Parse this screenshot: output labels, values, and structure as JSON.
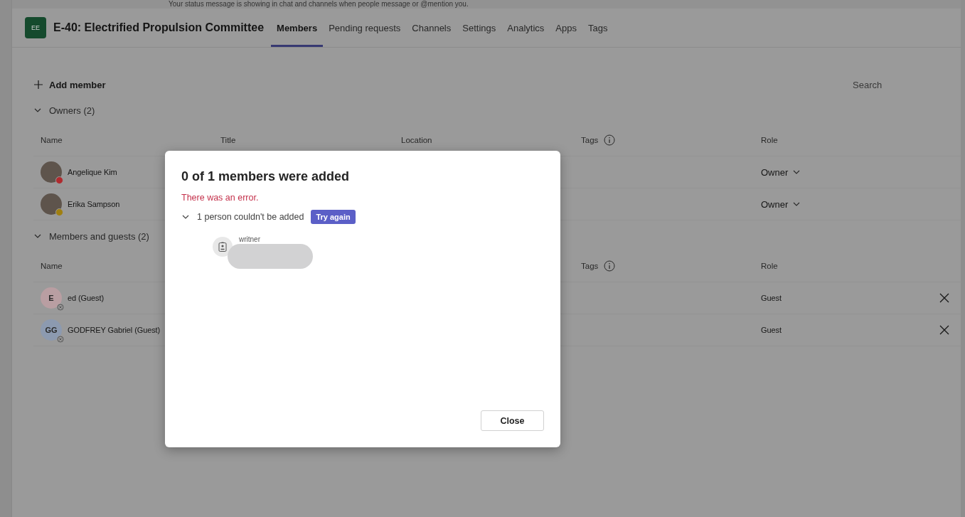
{
  "banner": {
    "text": "Your status message is showing in chat and channels when people message or @mention you."
  },
  "team": {
    "initials": "EE",
    "name": "E-40: Electrified Propulsion Committee"
  },
  "tabs": [
    {
      "label": "Members",
      "selected": true
    },
    {
      "label": "Pending requests",
      "selected": false
    },
    {
      "label": "Channels",
      "selected": false
    },
    {
      "label": "Settings",
      "selected": false
    },
    {
      "label": "Analytics",
      "selected": false
    },
    {
      "label": "Apps",
      "selected": false
    },
    {
      "label": "Tags",
      "selected": false
    }
  ],
  "add_member": "Add member",
  "search": {
    "placeholder": "Search"
  },
  "sections": [
    {
      "title": "Owners (2)",
      "expanded": true,
      "columns": {
        "name": "Name",
        "title": "Title",
        "location": "Location",
        "tags": "Tags",
        "role": "Role"
      },
      "members": [
        {
          "name": "Angelique Kim",
          "kind": "photo",
          "color": "#b02a2e",
          "role": "Owner",
          "role_menu": true,
          "removable": false
        },
        {
          "name": "Erika Sampson",
          "kind": "photo",
          "color": "#a07f10",
          "role": "Owner",
          "role_menu": true,
          "removable": false
        }
      ]
    },
    {
      "title": "Members and guests (2)",
      "expanded": true,
      "columns": {
        "name": "Name",
        "tags": "Tags",
        "role": "Role"
      },
      "members": [
        {
          "name": "ed (Guest)",
          "kind": "initials",
          "initials": "E",
          "color": "#b99ea2",
          "role": "Guest",
          "role_menu": false,
          "removable": true
        },
        {
          "name": "GODFREY Gabriel (Guest)",
          "kind": "initials",
          "initials": "GG",
          "color": "#8c9ab0",
          "role": "Guest",
          "role_menu": false,
          "removable": true
        }
      ]
    }
  ],
  "dialog": {
    "title": "0 of 1 members were added",
    "error": "There was an error.",
    "failed_summary": "1 person couldn't be added",
    "failed_expanded": true,
    "retry_button": "Try again",
    "failed_people": [
      {
        "name": "writner",
        "redacted": true
      }
    ],
    "close_button": "Close"
  }
}
